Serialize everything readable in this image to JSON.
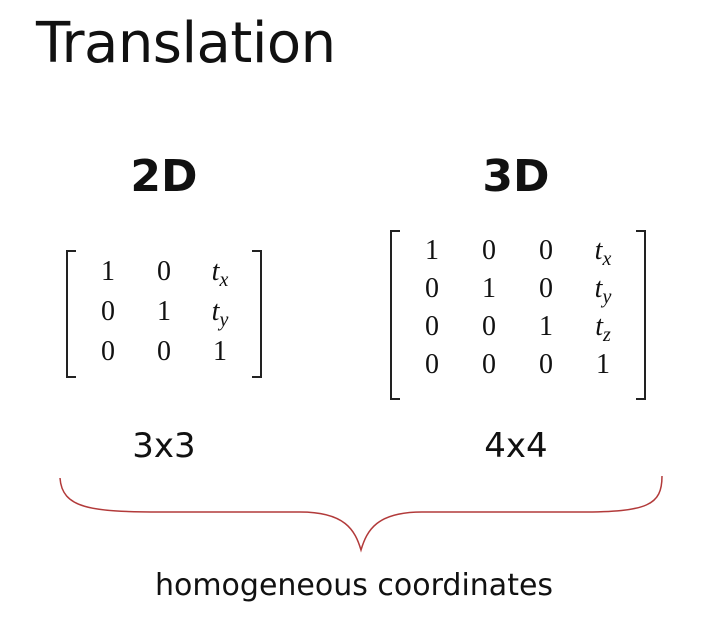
{
  "title": "Translation",
  "left": {
    "heading": "2D",
    "size": "3x3",
    "matrix": [
      [
        {
          "t": "1"
        },
        {
          "t": "0"
        },
        {
          "t": "t",
          "sub": "x"
        }
      ],
      [
        {
          "t": "0"
        },
        {
          "t": "1"
        },
        {
          "t": "t",
          "sub": "y"
        }
      ],
      [
        {
          "t": "0"
        },
        {
          "t": "0"
        },
        {
          "t": "1"
        }
      ]
    ]
  },
  "right": {
    "heading": "3D",
    "size": "4x4",
    "matrix": [
      [
        {
          "t": "1"
        },
        {
          "t": "0"
        },
        {
          "t": "0"
        },
        {
          "t": "t",
          "sub": "x"
        }
      ],
      [
        {
          "t": "0"
        },
        {
          "t": "1"
        },
        {
          "t": "0"
        },
        {
          "t": "t",
          "sub": "y"
        }
      ],
      [
        {
          "t": "0"
        },
        {
          "t": "0"
        },
        {
          "t": "1"
        },
        {
          "t": "t",
          "sub": "z"
        }
      ],
      [
        {
          "t": "0"
        },
        {
          "t": "0"
        },
        {
          "t": "0"
        },
        {
          "t": "1"
        }
      ]
    ]
  },
  "caption": "homogeneous coordinates",
  "colors": {
    "brace": "#b23a3a",
    "text": "#111111"
  }
}
